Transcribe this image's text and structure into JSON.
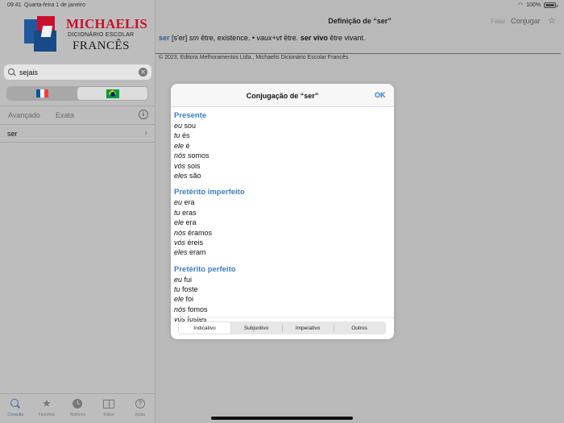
{
  "status": {
    "time": "09:41",
    "date": "Quarta-feira 1 de janeiro",
    "battery": "100%"
  },
  "sidebar": {
    "logo": {
      "title": "MICHAELIS",
      "subtitle": "DICIONÁRIO ESCOLAR",
      "language": "FRANCÊS"
    },
    "search": {
      "value": "sejais",
      "placeholder": ""
    },
    "modes": {
      "advanced": "Avançado",
      "exact": "Exata"
    },
    "results": [
      {
        "word": "ser"
      }
    ],
    "tabs": [
      {
        "label": "Consulta",
        "icon": "search-icon"
      },
      {
        "label": "Favoritos",
        "icon": "star-icon"
      },
      {
        "label": "Histórico",
        "icon": "clock-icon"
      },
      {
        "label": "Índice",
        "icon": "book-icon"
      },
      {
        "label": "Ajuda",
        "icon": "help-icon"
      }
    ],
    "colors": {
      "active_tab": "#4a6fa0",
      "flag_fr": [
        "#0055a4",
        "#ffffff",
        "#ef4135"
      ],
      "flag_br": "#009c3b"
    }
  },
  "main": {
    "nav": {
      "title": "Definição de “ser”",
      "speak": "Falar",
      "conjugate": "Conjugar"
    },
    "definition": {
      "headword": "ser",
      "pron": "[s'er]",
      "pos": "sm",
      "meaning": "être, existence. •",
      "pos2": "vaux+vt",
      "meaning2": "être.",
      "phrase": "ser vivo",
      "phrase_meaning": "être vivant."
    },
    "copyright": "© 2023, Editora Melhoramentos Ltda., Michaelis Dicionário Escolar Francês"
  },
  "modal": {
    "title": "Conjugação de “ser”",
    "ok": "OK",
    "tenses": [
      {
        "name": "Presente",
        "forms": [
          {
            "p": "eu",
            "v": "sou"
          },
          {
            "p": "tu",
            "v": "és"
          },
          {
            "p": "ele",
            "v": "é"
          },
          {
            "p": "nós",
            "v": "somos"
          },
          {
            "p": "vós",
            "v": "sois"
          },
          {
            "p": "eles",
            "v": "são"
          }
        ]
      },
      {
        "name": "Pretérito imperfeito",
        "forms": [
          {
            "p": "eu",
            "v": "era"
          },
          {
            "p": "tu",
            "v": "eras"
          },
          {
            "p": "ele",
            "v": "era"
          },
          {
            "p": "nós",
            "v": "éramos"
          },
          {
            "p": "vós",
            "v": "éreis"
          },
          {
            "p": "eles",
            "v": "eram"
          }
        ]
      },
      {
        "name": "Pretérito perfeito",
        "forms": [
          {
            "p": "eu",
            "v": "fui"
          },
          {
            "p": "tu",
            "v": "foste"
          },
          {
            "p": "ele",
            "v": "foi"
          },
          {
            "p": "nós",
            "v": "fomos"
          },
          {
            "p": "vós",
            "v": "fostes"
          }
        ]
      }
    ],
    "segments": [
      "Indicativo",
      "Subjuntivo",
      "Imperativo",
      "Outros"
    ],
    "active_segment": "Indicativo",
    "colors": {
      "tense_heading": "#3b7dc4",
      "ok": "#2f7fd1"
    }
  }
}
